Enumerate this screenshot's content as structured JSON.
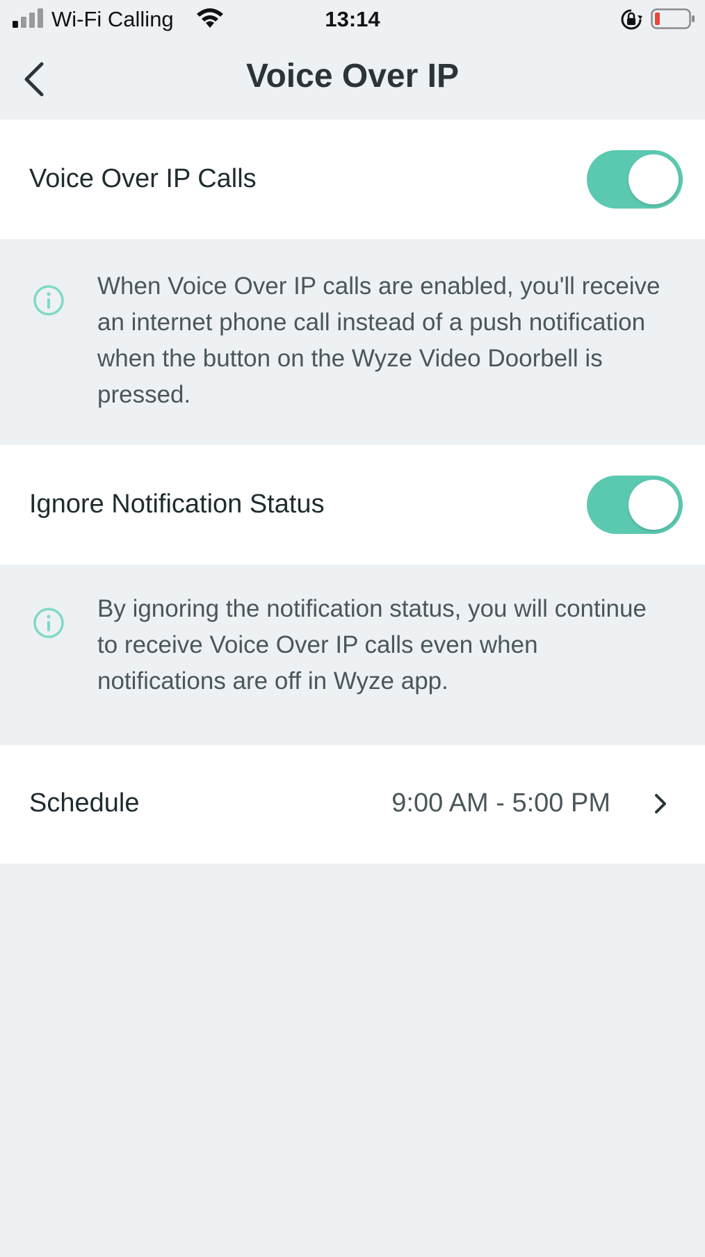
{
  "status_bar": {
    "carrier": "Wi-Fi Calling",
    "time": "13:14"
  },
  "nav": {
    "title": "Voice Over IP"
  },
  "voip_calls": {
    "label": "Voice Over IP Calls",
    "enabled": true,
    "info": "When Voice Over IP calls are enabled, you'll receive an internet phone call instead of a push notification when the button on the Wyze Video Doorbell is pressed."
  },
  "ignore_notification": {
    "label": "Ignore Notification Status",
    "enabled": true,
    "info": "By ignoring the notification status, you will continue to receive Voice Over IP calls even when notifications are off in Wyze app."
  },
  "schedule": {
    "label": "Schedule",
    "value": "9:00 AM - 5:00 PM"
  },
  "colors": {
    "accent": "#5bc9b0",
    "background": "#eef1f4",
    "battery_low": "#e8453c"
  },
  "icons": [
    "signal-icon",
    "wifi-icon",
    "rotation-lock-icon",
    "battery-icon",
    "back-chevron-icon",
    "info-icon",
    "chevron-right-icon"
  ]
}
